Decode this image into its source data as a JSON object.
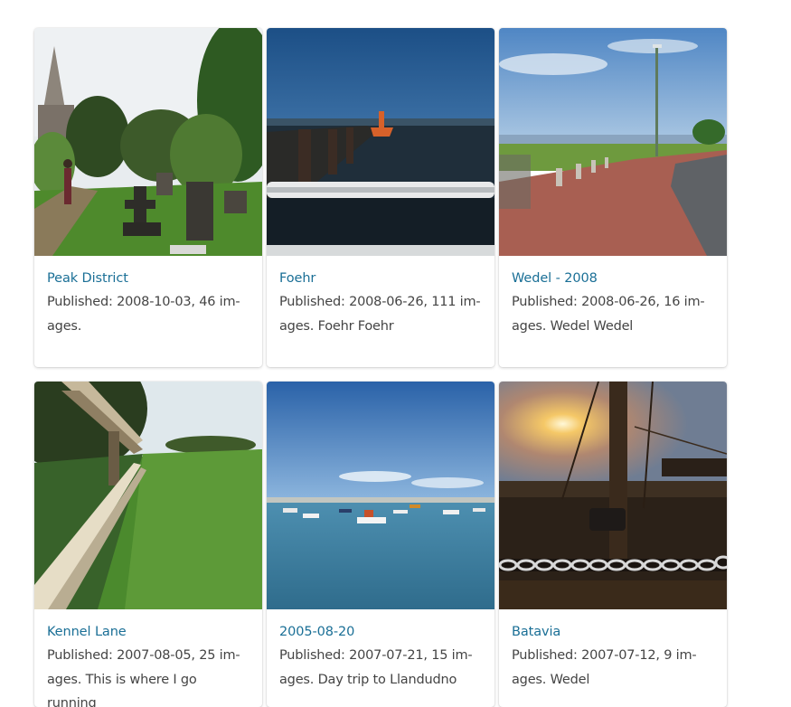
{
  "gallery": {
    "albums": [
      {
        "title": "Peak District",
        "published_label": "Published:",
        "date": "2008-10-03",
        "line1": "Published: 2008-10-03, 46 im-",
        "line2": "ages.",
        "line3": "",
        "image_alt": "churchyard-photo"
      },
      {
        "title": "Foehr",
        "published_label": "Published:",
        "date": "2008-06-26",
        "line1": "Published: 2008-06-26, 111 im-",
        "line2": "ages. Foehr Foehr",
        "line3": "",
        "image_alt": "pier-photo"
      },
      {
        "title": "Wedel - 2008",
        "published_label": "Published:",
        "date": "2008-06-26",
        "line1": "Published: 2008-06-26, 16 im-",
        "line2": "ages. Wedel Wedel",
        "line3": "",
        "image_alt": "promenade-photo"
      },
      {
        "title": "Kennel Lane",
        "published_label": "Published:",
        "date": "2007-08-05",
        "line1": "Published: 2007-08-05, 25 im-",
        "line2": "ages. This is where I go running",
        "line3": "",
        "image_alt": "fence-field-photo"
      },
      {
        "title": "2005-08-20",
        "published_label": "Published:",
        "date": "2007-07-21",
        "line1": "Published: 2007-07-21, 15 im-",
        "line2": "ages. Day trip to Llandudno",
        "line3": "",
        "image_alt": "harbour-boats-photo"
      },
      {
        "title": "Batavia",
        "published_label": "Published:",
        "date": "2007-07-12",
        "line1": "Published: 2007-07-12, 9 im-",
        "line2": "ages. Wedel",
        "line3": "",
        "image_alt": "sunset-chain-photo"
      }
    ]
  },
  "colors": {
    "link": "#1a6f96",
    "text": "#444444"
  }
}
